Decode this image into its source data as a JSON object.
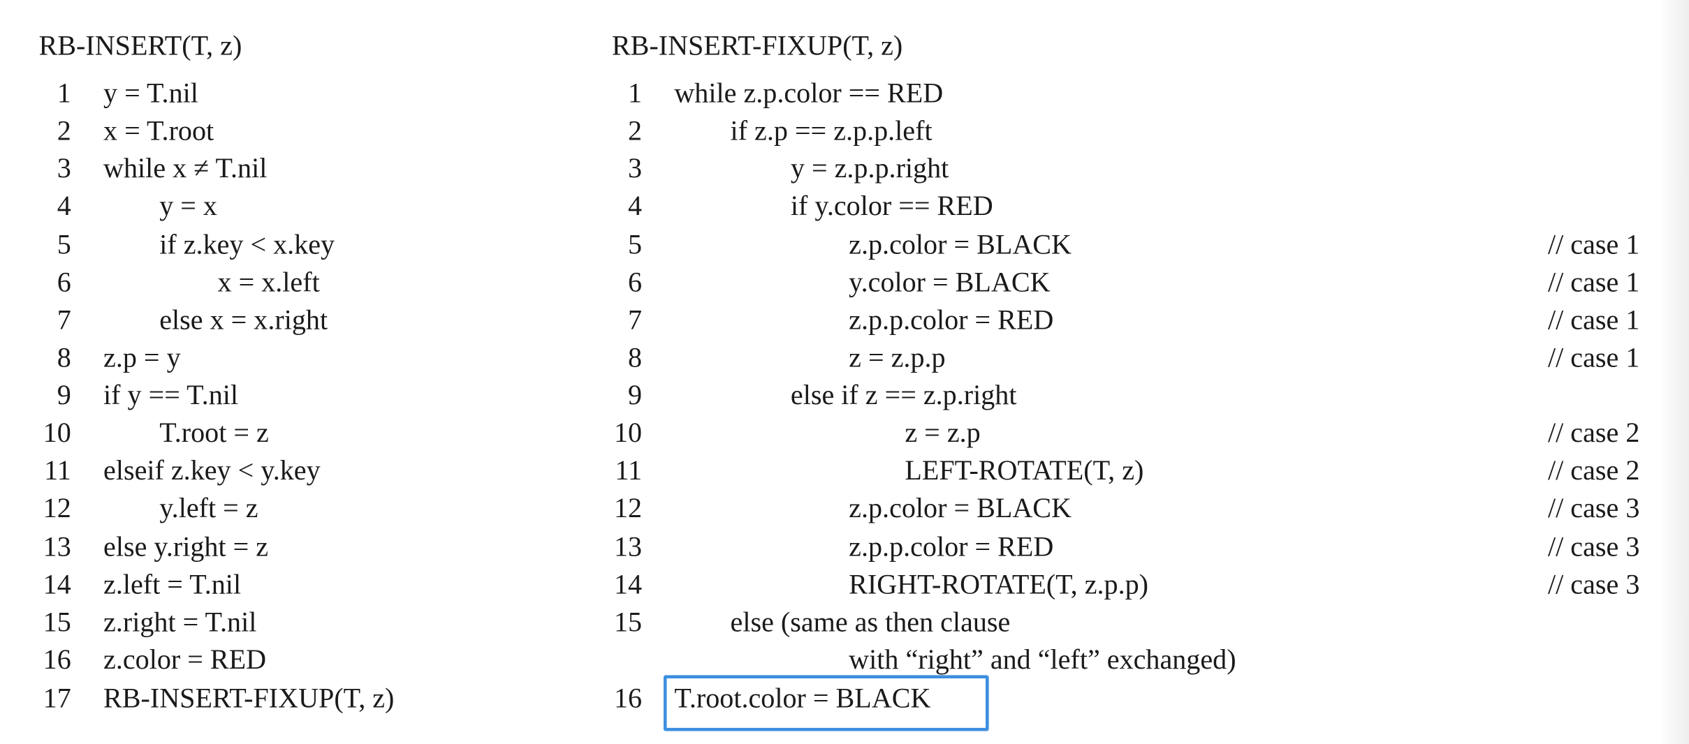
{
  "highlight_color": "#3d8fe0",
  "left": {
    "title": "RB-INSERT(T, z)",
    "lines": [
      {
        "num": "1",
        "text": "y = T.nil"
      },
      {
        "num": "2",
        "text": "x = T.root"
      },
      {
        "num": "3",
        "text": "while x ≠ T.nil"
      },
      {
        "num": "4",
        "text": "y = x"
      },
      {
        "num": "5",
        "text": "if z.key < x.key"
      },
      {
        "num": "6",
        "text": "x = x.left"
      },
      {
        "num": "7",
        "text": "else x = x.right"
      },
      {
        "num": "8",
        "text": "z.p = y"
      },
      {
        "num": "9",
        "text": "if y == T.nil"
      },
      {
        "num": "10",
        "text": "T.root = z"
      },
      {
        "num": "11",
        "text": "elseif z.key < y.key"
      },
      {
        "num": "12",
        "text": "y.left = z"
      },
      {
        "num": "13",
        "text": "else y.right = z"
      },
      {
        "num": "14",
        "text": "z.left = T.nil"
      },
      {
        "num": "15",
        "text": "z.right = T.nil"
      },
      {
        "num": "16",
        "text": "z.color = RED"
      },
      {
        "num": "17",
        "text": "RB-INSERT-FIXUP(T, z)"
      }
    ]
  },
  "right": {
    "title": "RB-INSERT-FIXUP(T, z)",
    "lines": [
      {
        "num": "1",
        "text": "while z.p.color == RED",
        "comment": ""
      },
      {
        "num": "2",
        "text": "if z.p == z.p.p.left",
        "comment": ""
      },
      {
        "num": "3",
        "text": "y = z.p.p.right",
        "comment": ""
      },
      {
        "num": "4",
        "text": "if y.color == RED",
        "comment": ""
      },
      {
        "num": "5",
        "text": "z.p.color = BLACK",
        "comment": "// case 1"
      },
      {
        "num": "6",
        "text": "y.color = BLACK",
        "comment": "// case 1"
      },
      {
        "num": "7",
        "text": "z.p.p.color = RED",
        "comment": "// case 1"
      },
      {
        "num": "8",
        "text": "z = z.p.p",
        "comment": "// case 1"
      },
      {
        "num": "9",
        "text": "else if z == z.p.right",
        "comment": ""
      },
      {
        "num": "10",
        "text": "z = z.p",
        "comment": "// case 2"
      },
      {
        "num": "11",
        "text": "LEFT-ROTATE(T, z)",
        "comment": "// case 2"
      },
      {
        "num": "12",
        "text": "z.p.color = BLACK",
        "comment": "// case 3"
      },
      {
        "num": "13",
        "text": "z.p.p.color = RED",
        "comment": "// case 3"
      },
      {
        "num": "14",
        "text": "RIGHT-ROTATE(T, z.p.p)",
        "comment": "// case 3"
      },
      {
        "num": "15",
        "text": "else (same as then clause",
        "comment": ""
      },
      {
        "num": "",
        "text": "with “right” and “left” exchanged)",
        "comment": ""
      },
      {
        "num": "16",
        "text": "T.root.color = BLACK",
        "comment": ""
      }
    ]
  }
}
